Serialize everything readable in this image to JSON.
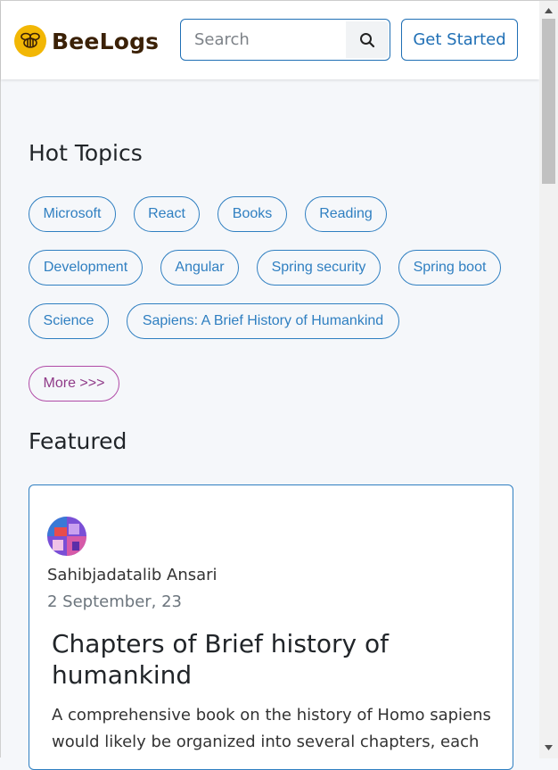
{
  "header": {
    "logo_text": "BeeLogs",
    "search_placeholder": "Search",
    "get_started_label": "Get Started"
  },
  "hot_topics": {
    "title": "Hot Topics",
    "tags": [
      "Microsoft",
      "React",
      "Books",
      "Reading",
      "Development",
      "Angular",
      "Spring security",
      "Spring boot",
      "Science",
      "Sapiens: A Brief History of Humankind"
    ],
    "more_label": "More >>>"
  },
  "featured": {
    "title": "Featured",
    "card": {
      "author": "Sahibjadatalib Ansari",
      "date": "2 September, 23",
      "title": "Chapters of Brief history of humankind",
      "description": "A comprehensive book on the history of Homo sapiens would likely be organized into several chapters, each"
    }
  },
  "colors": {
    "accent": "#1f6fb5",
    "logo_yellow": "#f2b705",
    "more_purple": "#b04aa6"
  }
}
